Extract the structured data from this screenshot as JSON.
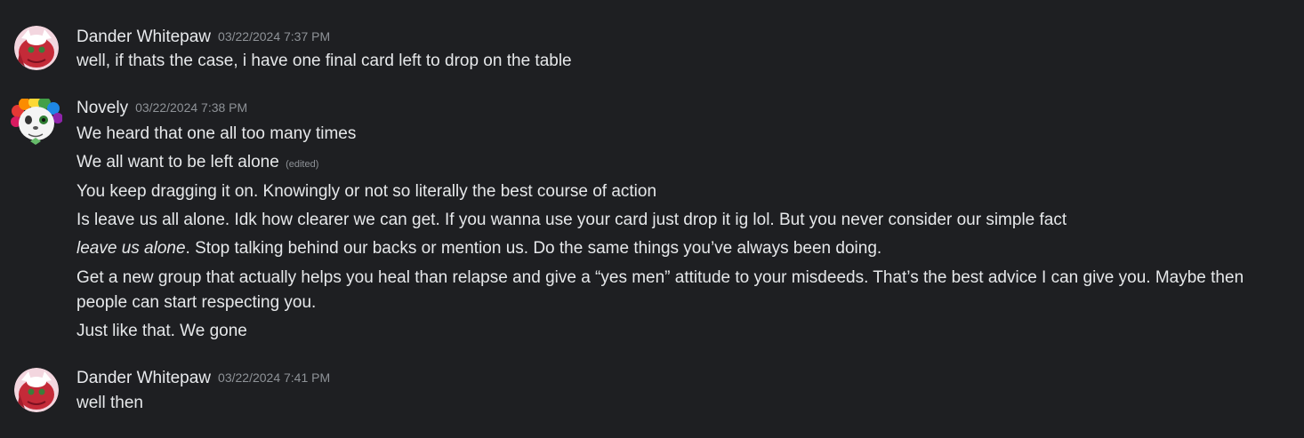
{
  "messages": [
    {
      "author": "Dander Whitepaw",
      "timestamp": "03/22/2024 7:37 PM",
      "avatar_icon": "red-dragon-avatar",
      "lines": [
        "well, if thats the case, i have one final card left to drop on the table"
      ]
    },
    {
      "author": "Novely",
      "timestamp": "03/22/2024 7:38 PM",
      "avatar_icon": "rainbow-clown-avatar",
      "lines": [
        "We heard that one all too many times",
        "We all want to be left alone",
        "You keep dragging it on. Knowingly or not so literally the best course of action",
        "Is leave us all alone. Idk how clearer we can get. If you wanna use your card just drop it ig lol. But you never consider our simple fact",
        "leave us alone",
        ". Stop talking behind our backs or mention us. Do the same things you’ve always been doing.",
        "Get a new group that actually helps you heal than relapse and give a “yes men” attitude to your misdeeds. That’s the best advice I can give you. Maybe then people can start respecting you.",
        "Just like that. We gone"
      ],
      "edited_label": "(edited)"
    },
    {
      "author": "Dander Whitepaw",
      "timestamp": "03/22/2024 7:41 PM",
      "avatar_icon": "red-dragon-avatar",
      "lines": [
        "well then"
      ]
    }
  ],
  "colors": {
    "background": "#1e1f22",
    "username": "#e8eaed",
    "timestamp": "#8e9297",
    "text": "#e6e8ea"
  }
}
